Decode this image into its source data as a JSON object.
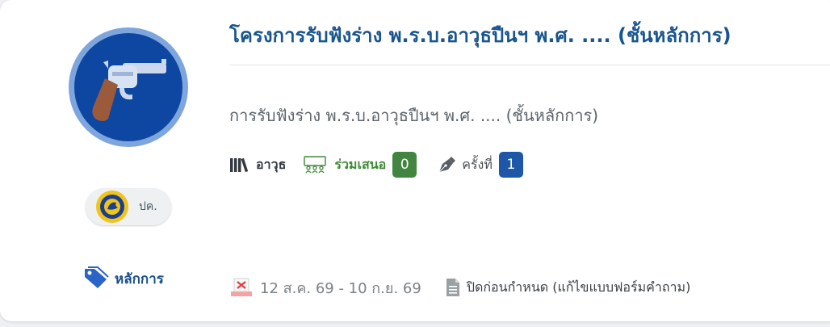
{
  "survey": {
    "title": "โครงการรับฟังร่าง พ.ร.บ.อาวุธปืนฯ พ.ศ. .... (ชั้นหลักการ)",
    "subtitle": "การรับฟังร่าง พ.ร.บ.อาวุธปืนฯ พ.ศ. .... (ชั้นหลักการ)",
    "icon": "revolver-icon",
    "organization": {
      "name": "ปค.",
      "logo": "department-seal-icon"
    },
    "type_tag": {
      "label": "หลักการ",
      "icon": "tag-icon"
    },
    "category": {
      "label": "อาวุธ",
      "icon": "books-icon"
    },
    "participation": {
      "label": "ร่วมเสนอ",
      "count": "0",
      "icon": "group-icon"
    },
    "round": {
      "label": "ครั้งที่",
      "number": "1",
      "icon": "pen-icon"
    },
    "period": {
      "text": "12 ส.ค. 69 - 10 ก.ย. 69",
      "icon": "calendar-closed-icon"
    },
    "status": {
      "text": "ปิดก่อนกำหนด (แก้ไขแบบฟอร์มคำถาม)",
      "icon": "document-icon"
    }
  },
  "colors": {
    "title": "#19558f",
    "avatar_bg": "#0d47a1",
    "avatar_ring": "#7fa6dc",
    "participation": "#418540",
    "round_badge": "#1e56a8"
  }
}
